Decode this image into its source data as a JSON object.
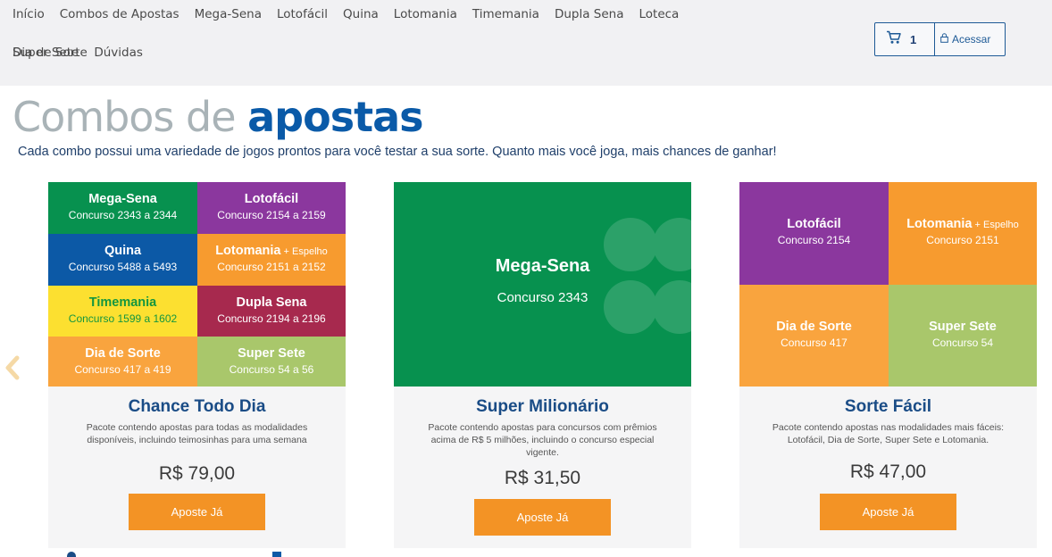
{
  "nav": {
    "items": [
      "Início",
      "Combos de Apostas",
      "Mega-Sena",
      "Lotofácil",
      "Quina",
      "Lotomania",
      "Timemania",
      "Dupla Sena",
      "Loteca",
      "Dia de Sorte",
      "Super Sete",
      "Dúvidas"
    ]
  },
  "cart": {
    "count": "1",
    "icon": "cart-icon"
  },
  "login": {
    "label": "Acessar",
    "icon": "lock-icon"
  },
  "hero": {
    "title_light": "Combos de ",
    "title_bold": "apostas",
    "subtitle": "Cada combo possui uma variedade de jogos prontos para você testar a sua sorte. Quanto mais você joga, mais chances de ganhar!"
  },
  "colors": {
    "megasena": "#07914f",
    "lotofacil": "#8b379e",
    "quina": "#0c59a6",
    "lotomania": "#f79b2f",
    "timemania": "#fce030",
    "timemania_text": "#14963f",
    "duplasena": "#a7294e",
    "diadesorte": "#f9a43e",
    "supersete": "#a9c76b",
    "button": "#f39325",
    "title_blue": "#1a4c86"
  },
  "cards": [
    {
      "tiles": [
        {
          "name": "Mega-Sena",
          "extra": "",
          "sub": "Concurso 2343 a 2344"
        },
        {
          "name": "Lotofácil",
          "extra": "",
          "sub": "Concurso 2154 a 2159"
        },
        {
          "name": "Quina",
          "extra": "",
          "sub": "Concurso 5488 a 5493"
        },
        {
          "name": "Lotomania",
          "extra": " + Espelho",
          "sub": "Concurso 2151 a 2152"
        },
        {
          "name": "Timemania",
          "extra": "",
          "sub": "Concurso 1599 a 1602"
        },
        {
          "name": "Dupla Sena",
          "extra": "",
          "sub": "Concurso 2194 a 2196"
        },
        {
          "name": "Dia de Sorte",
          "extra": "",
          "sub": "Concurso 417 a 419"
        },
        {
          "name": "Super Sete",
          "extra": "",
          "sub": "Concurso 54 a 56"
        }
      ],
      "title": "Chance Todo Dia",
      "description": "Pacote contendo apostas para todas as modalidades disponíveis, incluindo teimosinhas para uma semana",
      "price": "R$ 79,00",
      "button": "Aposte Já"
    },
    {
      "tiles": [
        {
          "name": "Mega-Sena",
          "extra": "",
          "sub": "Concurso 2343"
        }
      ],
      "title": "Super Milionário",
      "description": "Pacote contendo apostas para concursos com prêmios acima de R$ 5 milhões, incluindo o concurso especial vigente.",
      "price": "R$ 31,50",
      "button": "Aposte Já"
    },
    {
      "tiles": [
        {
          "name": "Lotofácil",
          "extra": "",
          "sub": "Concurso 2154"
        },
        {
          "name": "Lotomania",
          "extra": " + Espelho",
          "sub": "Concurso 2151"
        },
        {
          "name": "Dia de Sorte",
          "extra": "",
          "sub": "Concurso 417"
        },
        {
          "name": "Super Sete",
          "extra": "",
          "sub": "Concurso 54"
        }
      ],
      "title": "Sorte Fácil",
      "description": "Pacote contendo apostas nas modalidades mais fáceis: Lotofácil, Dia de Sorte, Super Sete e Lotomania.",
      "price": "R$ 47,00",
      "button": "Aposte Já"
    }
  ],
  "carousel": {
    "prev_icon": "chevron-left-icon"
  }
}
